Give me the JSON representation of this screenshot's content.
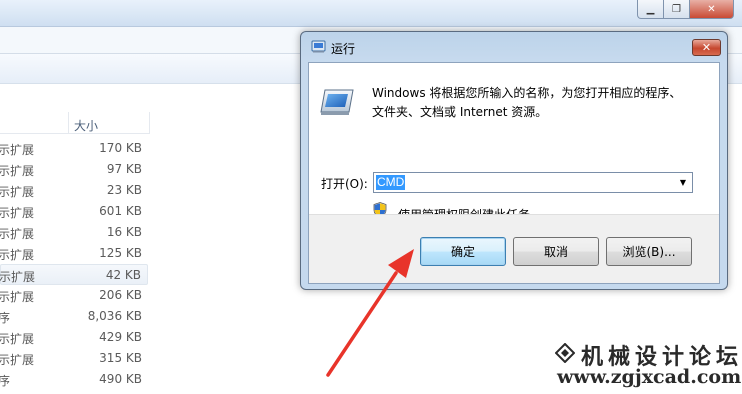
{
  "explorer": {
    "column_header_size": "大小",
    "files": [
      {
        "type": "示扩展",
        "size": "170 KB"
      },
      {
        "type": "示扩展",
        "size": "97 KB"
      },
      {
        "type": "示扩展",
        "size": "23 KB"
      },
      {
        "type": "示扩展",
        "size": "601 KB"
      },
      {
        "type": "示扩展",
        "size": "16 KB"
      },
      {
        "type": "示扩展",
        "size": "125 KB"
      },
      {
        "type": "示扩展",
        "size": "42 KB",
        "selected": true
      },
      {
        "type": "示扩展",
        "size": "206 KB"
      },
      {
        "type": "序",
        "size": "8,036 KB"
      },
      {
        "type": "示扩展",
        "size": "429 KB"
      },
      {
        "type": "示扩展",
        "size": "315 KB"
      },
      {
        "type": "序",
        "size": "490 KB"
      }
    ]
  },
  "run_dialog": {
    "title": "运行",
    "description_line1": "Windows 将根据您所输入的名称，为您打开相应的程序、",
    "description_line2": "文件夹、文档或 Internet 资源。",
    "open_label": "打开(O):",
    "input_value": "CMD",
    "admin_note": "使用管理权限创建此任务。",
    "buttons": {
      "ok": "确定",
      "cancel": "取消",
      "browse": "浏览(B)..."
    }
  },
  "watermark": {
    "title": "机械设计论坛",
    "url": "www.zgjxcad.com"
  },
  "colors": {
    "selection": "#3399ff",
    "arrow": "#e8342a",
    "dialog_frame": "#c5d9ee"
  }
}
